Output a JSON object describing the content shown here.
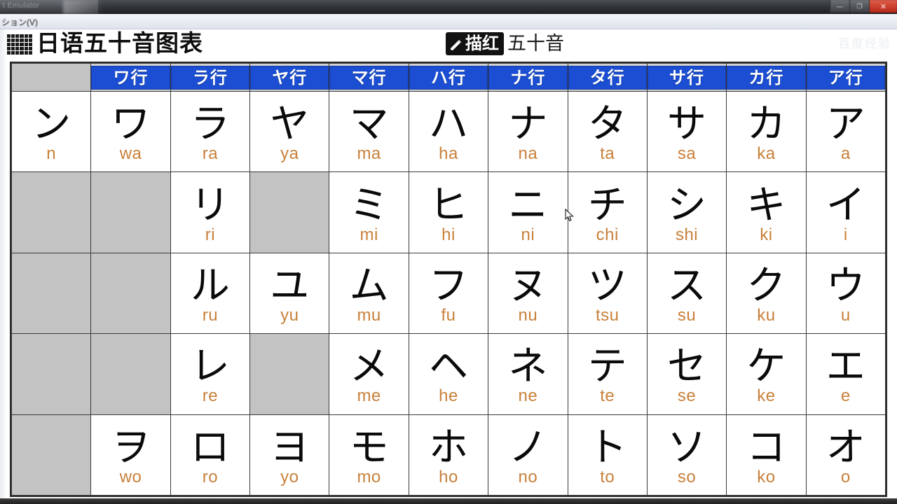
{
  "window": {
    "title": "t Emulator",
    "controls": [
      {
        "name": "minimize",
        "glyph": "—"
      },
      {
        "name": "maximize",
        "glyph": "❐"
      },
      {
        "name": "close",
        "glyph": "✕"
      }
    ],
    "menu_item": "ション(V)"
  },
  "header": {
    "app_title": "日语五十音图表",
    "mode_button_label": "描红",
    "mode_suffix": "五十音",
    "watermark": "百度经验"
  },
  "grid": {
    "corner_label": "",
    "column_headers": [
      "ワ行",
      "ラ行",
      "ヤ行",
      "マ行",
      "ハ行",
      "ナ行",
      "タ行",
      "サ行",
      "カ行",
      "ア行"
    ],
    "first_column_header": "",
    "rows": [
      {
        "row_index": 1,
        "leading": {
          "kana": "ン",
          "romaji": "n",
          "empty": false
        },
        "cells": [
          {
            "kana": "ワ",
            "romaji": "wa",
            "empty": false
          },
          {
            "kana": "ラ",
            "romaji": "ra",
            "empty": false
          },
          {
            "kana": "ヤ",
            "romaji": "ya",
            "empty": false
          },
          {
            "kana": "マ",
            "romaji": "ma",
            "empty": false
          },
          {
            "kana": "ハ",
            "romaji": "ha",
            "empty": false
          },
          {
            "kana": "ナ",
            "romaji": "na",
            "empty": false
          },
          {
            "kana": "タ",
            "romaji": "ta",
            "empty": false
          },
          {
            "kana": "サ",
            "romaji": "sa",
            "empty": false
          },
          {
            "kana": "カ",
            "romaji": "ka",
            "empty": false
          },
          {
            "kana": "ア",
            "romaji": "a",
            "empty": false
          }
        ]
      },
      {
        "row_index": 2,
        "leading": {
          "kana": "",
          "romaji": "",
          "empty": true
        },
        "cells": [
          {
            "kana": "",
            "romaji": "",
            "empty": true
          },
          {
            "kana": "リ",
            "romaji": "ri",
            "empty": false
          },
          {
            "kana": "",
            "romaji": "",
            "empty": true
          },
          {
            "kana": "ミ",
            "romaji": "mi",
            "empty": false
          },
          {
            "kana": "ヒ",
            "romaji": "hi",
            "empty": false
          },
          {
            "kana": "ニ",
            "romaji": "ni",
            "empty": false
          },
          {
            "kana": "チ",
            "romaji": "chi",
            "empty": false
          },
          {
            "kana": "シ",
            "romaji": "shi",
            "empty": false
          },
          {
            "kana": "キ",
            "romaji": "ki",
            "empty": false
          },
          {
            "kana": "イ",
            "romaji": "i",
            "empty": false
          }
        ]
      },
      {
        "row_index": 3,
        "leading": {
          "kana": "",
          "romaji": "",
          "empty": true
        },
        "cells": [
          {
            "kana": "",
            "romaji": "",
            "empty": true
          },
          {
            "kana": "ル",
            "romaji": "ru",
            "empty": false
          },
          {
            "kana": "ユ",
            "romaji": "yu",
            "empty": false
          },
          {
            "kana": "ム",
            "romaji": "mu",
            "empty": false
          },
          {
            "kana": "フ",
            "romaji": "fu",
            "empty": false
          },
          {
            "kana": "ヌ",
            "romaji": "nu",
            "empty": false
          },
          {
            "kana": "ツ",
            "romaji": "tsu",
            "empty": false
          },
          {
            "kana": "ス",
            "romaji": "su",
            "empty": false
          },
          {
            "kana": "ク",
            "romaji": "ku",
            "empty": false
          },
          {
            "kana": "ウ",
            "romaji": "u",
            "empty": false
          }
        ]
      },
      {
        "row_index": 4,
        "leading": {
          "kana": "",
          "romaji": "",
          "empty": true
        },
        "cells": [
          {
            "kana": "",
            "romaji": "",
            "empty": true
          },
          {
            "kana": "レ",
            "romaji": "re",
            "empty": false
          },
          {
            "kana": "",
            "romaji": "",
            "empty": true
          },
          {
            "kana": "メ",
            "romaji": "me",
            "empty": false
          },
          {
            "kana": "ヘ",
            "romaji": "he",
            "empty": false
          },
          {
            "kana": "ネ",
            "romaji": "ne",
            "empty": false
          },
          {
            "kana": "テ",
            "romaji": "te",
            "empty": false
          },
          {
            "kana": "セ",
            "romaji": "se",
            "empty": false
          },
          {
            "kana": "ケ",
            "romaji": "ke",
            "empty": false
          },
          {
            "kana": "エ",
            "romaji": "e",
            "empty": false
          }
        ]
      },
      {
        "row_index": 5,
        "leading": {
          "kana": "",
          "romaji": "",
          "empty": true
        },
        "cells": [
          {
            "kana": "ヲ",
            "romaji": "wo",
            "empty": false
          },
          {
            "kana": "ロ",
            "romaji": "ro",
            "empty": false
          },
          {
            "kana": "ヨ",
            "romaji": "yo",
            "empty": false
          },
          {
            "kana": "モ",
            "romaji": "mo",
            "empty": false
          },
          {
            "kana": "ホ",
            "romaji": "ho",
            "empty": false
          },
          {
            "kana": "ノ",
            "romaji": "no",
            "empty": false
          },
          {
            "kana": "ト",
            "romaji": "to",
            "empty": false
          },
          {
            "kana": "ソ",
            "romaji": "so",
            "empty": false
          },
          {
            "kana": "コ",
            "romaji": "ko",
            "empty": false
          },
          {
            "kana": "オ",
            "romaji": "o",
            "empty": false
          }
        ]
      }
    ]
  },
  "colors": {
    "header_blue": "#1b4ed2",
    "header_text": "#ffffff",
    "empty_cell_gray": "#c3c3c3",
    "romaji_orange": "#c8803a",
    "kana_black": "#0a0a0a",
    "grid_border": "#2b2b2b",
    "close_button_red": "#b8281a"
  }
}
